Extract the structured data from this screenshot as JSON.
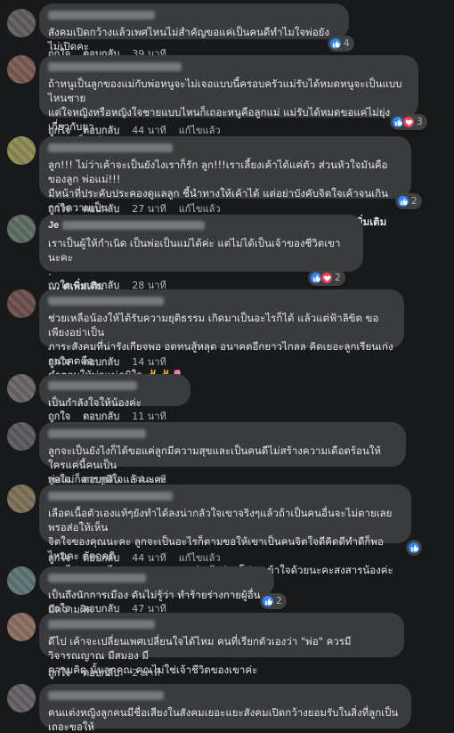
{
  "actions": {
    "like": "ถูกใจ",
    "reply": "ตอบกลับ",
    "edited": "แก้ไขแล้ว"
  },
  "colors": {
    "background": "#18191a",
    "bubble": "#3a3b3c",
    "text": "#e4e6eb",
    "meta": "#b0b3b8",
    "like": "#2d88ff",
    "love": "#f33e58"
  },
  "comments": [
    {
      "text": "สังคมเปิดกว้างแล้วเพศไหนไม่สำคัญขอแค่เป็นคนดีทำไมใจพ่อยังไม่เปิดคะ",
      "time": "39 นาที",
      "reaction_count": "4",
      "reactions": [
        "like-icon"
      ]
    },
    {
      "text": "ถ้าหนูเป็นลูกของแม่กับพ่อหนูจะไม่เจอแบบนี้ครอบครัวแม่รับได้หมดหนูจะเป็นแบบไหนชาย\nแต่ใจหญิงหรือหญิงใจชายแบบไหนก็เถอะหนูคือลูกแม่ แม่รับได้หมดขอแค่ไม่ยุ่งเกี่ยวกับยา\nเสพติดก็พอสุ้นะคะ",
      "time": "44 นาที",
      "edited": true,
      "reaction_count": "3",
      "reactions": [
        "like-icon",
        "love-icon"
      ]
    },
    {
      "text": "ลูก!!! ไม่ว่าเค้าจะเป็นยังไงเราก็รัก ลูก!!!เราเลี้ยงเค้าได้แค่ตัว ส่วนหัวใจมันคือของลูก พ่อแม่!!!\nมีหน้าที่ประคับประคองดูแลลูก ชี้นำทางให้เค้าได้ แต่อย่าบังคับจิตใจเค้าจนเกินกว่าความเป็น\nจริง!!! ลูกจะเป็นแบบไหนไม่ได้ตั้งใจพ่อแม่ สิ่งที่พ่อแม่ต้องทำคือ ท...",
      "see_more": "ดูเพิ่มเติม",
      "time": "27 นาที",
      "edited": true,
      "reaction_count": "2",
      "reactions": [
        "like-icon"
      ]
    },
    {
      "name_prefix": "Je",
      "text": "เราเป็นผู้ให้กำเนิด เป็นพ่อเป็นแม่ได้ค่ะ แต่ไม่ได้เป็นเจ้าของชีวิตเขานะคะ\n.",
      "see_more": "... ดูเพิ่มเติม",
      "time": "28 นาที",
      "reaction_count": "2",
      "reactions": [
        "like-icon",
        "love-icon"
      ]
    },
    {
      "text": "ช่วยเหลือน้องให้ได้รับความยุติธรรม เกิดมาเป็นอะไรก็ได้ แล้วแต่ฟ้าลิขิต ขอเพียงอย่าเป็น\nภาระสังคมที่น่ารังเกียจพอ อดทนสู้หลุด อนาคตอีกยาวไกลล คิดเยอะลูกเรียนเก่ง อนาคตคือ\nคำตอบให้พ่อแม่ภูมิใจ ✌️✌️🌷",
      "time": "14 นาที"
    },
    {
      "text": "เป็นกำลังใจให้น้องค่ะ",
      "time": "11 นาที"
    },
    {
      "text": "ลูกจะเป็นยังไงก็ได้ขอแค่ลูกมีความสุขและเป็นคนดีไม่สร้างความเดือดร้อนให้ใครแค่นี้คนเป็น\nพ่อแม่ก็ควรภูมิใจแล้วนะคะ",
      "time": "54 นาที"
    },
    {
      "text": "เลือดเนื้อตัวเองแท้ๆยังทำได้ลงน่ากลัวใจเขาจริงๆแล้วถ้าเป็นคนอื่นจะไม่ตายเลยพรอส่อให้เห็น\nจิตใจของคุณนะคะ ลูกจะเป็นอะไรก็ตามขอให้เขาเป็นคนจิตใจดีคิดดีทำดีก็พอไหมคะ ตัดอคติ\nออกไปคุณจะมีความสุขนะคะคุณพ่อ ถ้าอ่านโปรดเข้าใจด้วยนะคะสงสารน้องค่ะ",
      "time": "44 นาที",
      "edited": true,
      "reactions": [
        "like-icon"
      ]
    },
    {
      "text": "เป็นถึงนักการเมือง ดันไม่รู้ว่า ทำร้ายร่างกายผู้อื่นมีความผิด",
      "time": "47 นาที",
      "reaction_count": "2",
      "reactions": [
        "like-icon"
      ]
    },
    {
      "text": "ดีไป เค้าจะเปลี่ยนเพศเปลี่ยนใจได้ไหม คนที่เรียกตัวเองว่า \"พ่อ\" ควรมีวิจารณญาณ มีสมอง มี\nความคิด นั้นลูกคุณ คุณไม่ใช่เจ้าชีวิตของเขาค่ะ",
      "time": "2 นาที"
    },
    {
      "text": "คนแต่งหญิงลูกคนมีชื่อเสียงในสังคมเยอะแยะสังคมเปิดกว้างยอมรับในสิ่งที่ลูกเป็นเถอะขอให้\nเขาเป็นคนดีก็น่าจะภูมิใจนะ"
    }
  ]
}
